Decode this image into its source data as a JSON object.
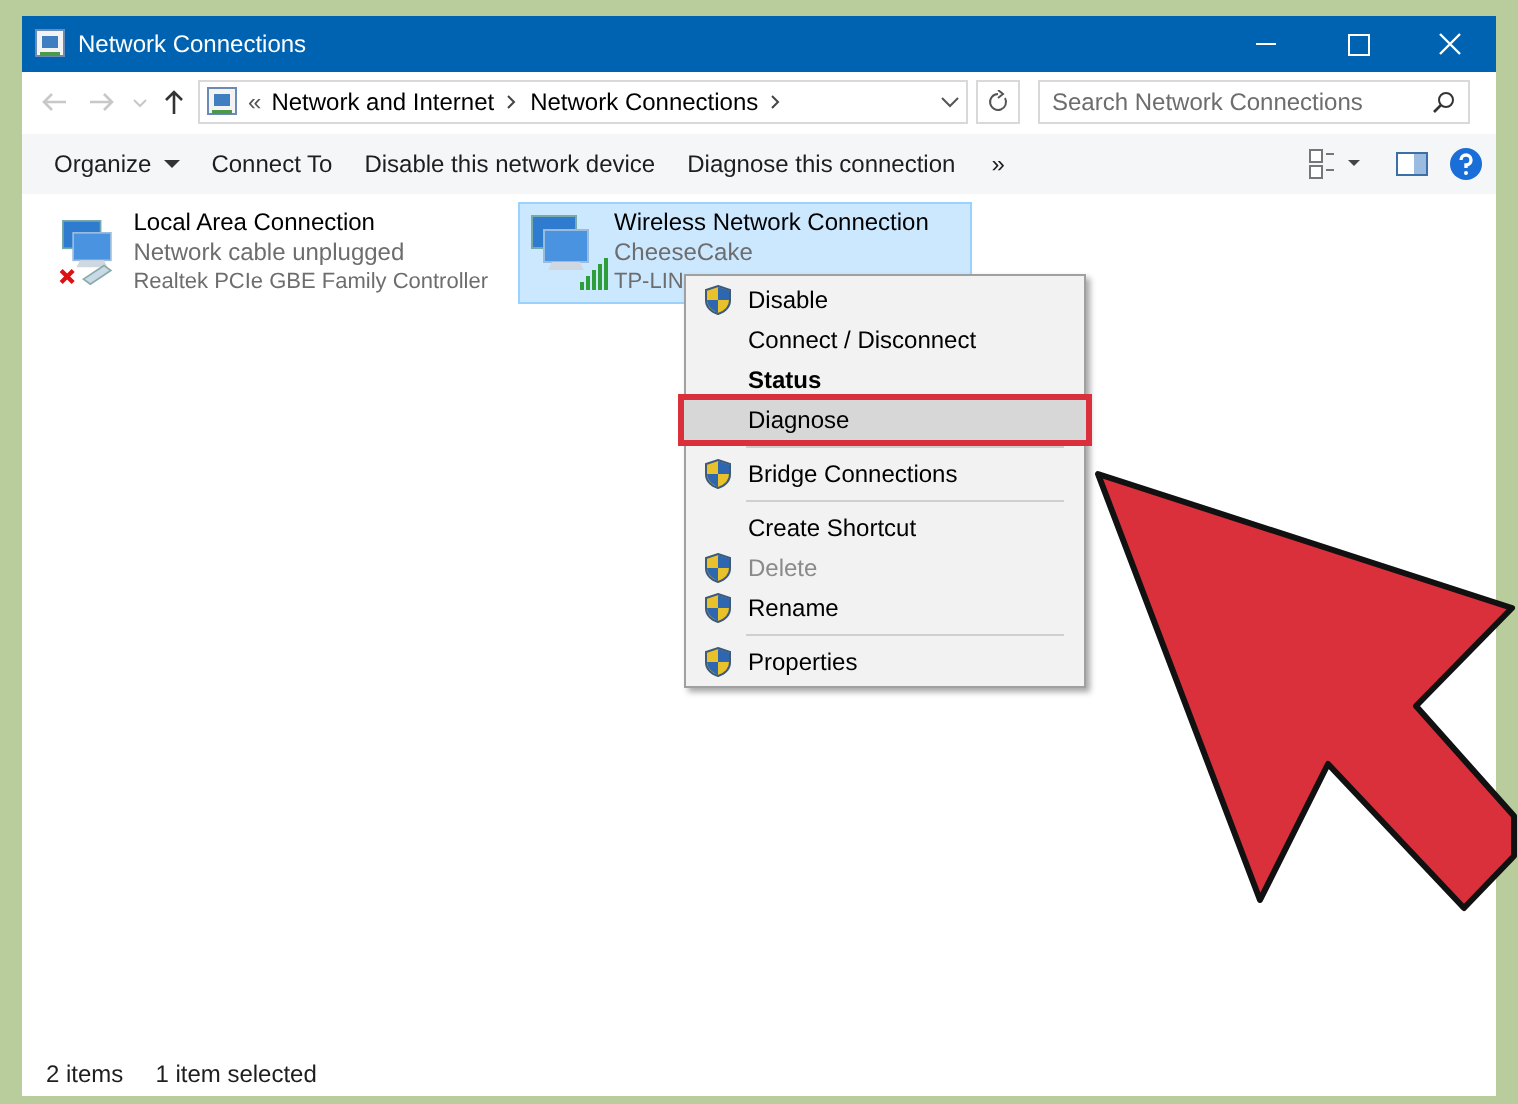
{
  "window": {
    "title": "Network Connections"
  },
  "address": {
    "overflow": "«",
    "crumbs": [
      "Network and Internet",
      "Network Connections"
    ]
  },
  "search": {
    "placeholder": "Search Network Connections"
  },
  "toolbar": {
    "items": [
      {
        "label": "Organize",
        "dropdown": true
      },
      {
        "label": "Connect To",
        "dropdown": false
      },
      {
        "label": "Disable this network device",
        "dropdown": false
      },
      {
        "label": "Diagnose this connection",
        "dropdown": false
      }
    ],
    "more": "»"
  },
  "connections": [
    {
      "name": "Local Area Connection",
      "line_1": "Network cable unplugged",
      "line_2": "Realtek PCIe GBE Family Controller",
      "kind": "wired",
      "selected": false
    },
    {
      "name": "Wireless Network Connection",
      "line_1": "CheeseCake",
      "line_2": "TP-LIN",
      "kind": "wireless",
      "selected": true
    }
  ],
  "context_menu": [
    {
      "kind": "item",
      "label": "Disable",
      "shield": true,
      "bold": false,
      "disabled": false,
      "selected": false
    },
    {
      "kind": "item",
      "label": "Connect / Disconnect",
      "shield": false,
      "bold": false,
      "disabled": false,
      "selected": false
    },
    {
      "kind": "item",
      "label": "Status",
      "shield": false,
      "bold": true,
      "disabled": false,
      "selected": false
    },
    {
      "kind": "item",
      "label": "Diagnose",
      "shield": false,
      "bold": false,
      "disabled": false,
      "selected": true
    },
    {
      "kind": "separator"
    },
    {
      "kind": "item",
      "label": "Bridge Connections",
      "shield": true,
      "bold": false,
      "disabled": false,
      "selected": false
    },
    {
      "kind": "separator"
    },
    {
      "kind": "item",
      "label": "Create Shortcut",
      "shield": false,
      "bold": false,
      "disabled": false,
      "selected": false
    },
    {
      "kind": "item",
      "label": "Delete",
      "shield": true,
      "bold": false,
      "disabled": true,
      "selected": false
    },
    {
      "kind": "item",
      "label": "Rename",
      "shield": true,
      "bold": false,
      "disabled": false,
      "selected": false
    },
    {
      "kind": "separator"
    },
    {
      "kind": "item",
      "label": "Properties",
      "shield": true,
      "bold": false,
      "disabled": false,
      "selected": false
    }
  ],
  "status_bar": [
    "2 items",
    "1 item selected"
  ]
}
